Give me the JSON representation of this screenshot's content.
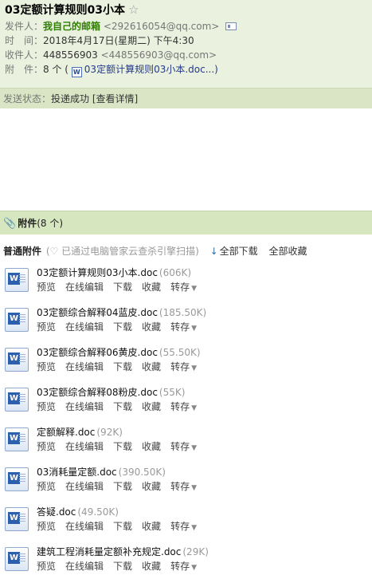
{
  "email": {
    "subject": "03定额计算规则03小本",
    "star_icon": "☆",
    "sender": {
      "label": "发件人：",
      "name": "我自己的邮箱",
      "address": "<292616054@qq.com>"
    },
    "time": {
      "label": "时　间：",
      "value": "2018年4月17日(星期二) 下午4:30"
    },
    "recipient": {
      "label": "收件人：",
      "name": "448556903",
      "address": "<448556903@qq.com>"
    },
    "attachments_meta": {
      "label": "附　件：",
      "count_text": "8 个 (",
      "first_file": "03定额计算规则03小本.doc...)"
    }
  },
  "send_status": {
    "label": "发送状态：",
    "value": "投递成功",
    "details_link": "[查看详情]"
  },
  "attachments_section": {
    "title": "附件",
    "count": "(8 个)"
  },
  "toolbar": {
    "title": "普通附件",
    "scan_text": "(♡ 已通过电脑管家云查杀引擎扫描)",
    "download_all": "全部下载",
    "save_all": "全部收藏"
  },
  "actions": {
    "preview": "预览",
    "online_edit": "在线编辑",
    "download": "下载",
    "save": "收藏",
    "forward": "转存"
  },
  "files": [
    {
      "name": "03定额计算规则03小本.doc",
      "size": "(606K)"
    },
    {
      "name": "03定额综合解释04蓝皮.doc",
      "size": "(185.50K)"
    },
    {
      "name": "03定额综合解释06黄皮.doc",
      "size": "(55.50K)"
    },
    {
      "name": "03定额综合解释08粉皮.doc",
      "size": "(55K)"
    },
    {
      "name": "定额解释.doc",
      "size": "(92K)"
    },
    {
      "name": "03消耗量定额.doc",
      "size": "(390.50K)"
    },
    {
      "name": "答疑.doc",
      "size": "(49.50K)"
    },
    {
      "name": "建筑工程消耗量定额补充规定.doc",
      "size": "(29K)"
    }
  ]
}
